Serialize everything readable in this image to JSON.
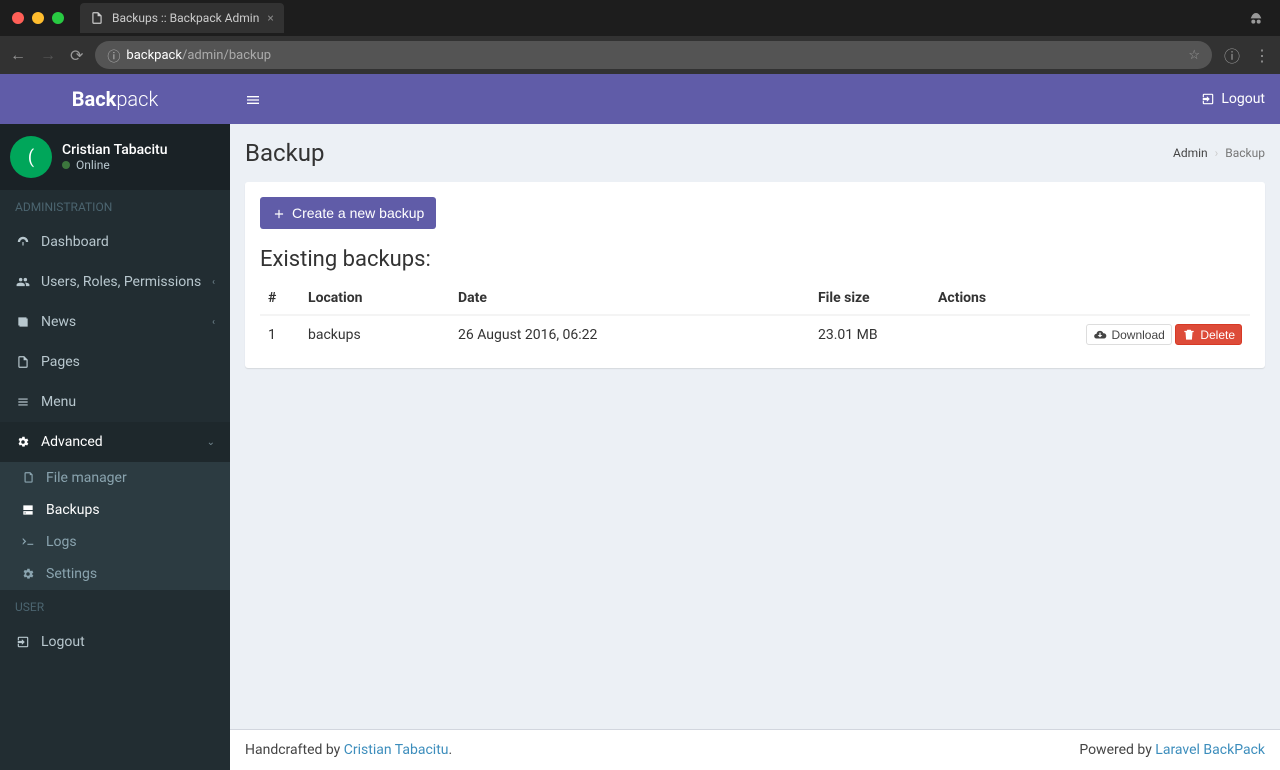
{
  "browser": {
    "tab_title": "Backups :: Backpack Admin",
    "url_host": "backpack",
    "url_path": "/admin/backup"
  },
  "brand": {
    "bold": "Back",
    "light": "pack"
  },
  "topbar": {
    "logout": "Logout"
  },
  "user": {
    "name": "Cristian Tabacitu",
    "status": "Online",
    "avatar_initial": "("
  },
  "sidebar": {
    "section_admin": "ADMINISTRATION",
    "section_user": "USER",
    "items": {
      "dashboard": "Dashboard",
      "users": "Users, Roles, Permissions",
      "news": "News",
      "pages": "Pages",
      "menu": "Menu",
      "advanced": "Advanced",
      "logout": "Logout"
    },
    "advanced_sub": {
      "file_manager": "File manager",
      "backups": "Backups",
      "logs": "Logs",
      "settings": "Settings"
    }
  },
  "page": {
    "title": "Backup",
    "breadcrumb_admin": "Admin",
    "breadcrumb_current": "Backup",
    "create_button": "Create a new backup",
    "section_title": "Existing backups:",
    "columns": {
      "num": "#",
      "location": "Location",
      "date": "Date",
      "size": "File size",
      "actions": "Actions"
    },
    "rows": [
      {
        "num": "1",
        "location": "backups",
        "date": "26 August 2016, 06:22",
        "size": "23.01 MB"
      }
    ],
    "action_download": "Download",
    "action_delete": "Delete"
  },
  "footer": {
    "left_prefix": "Handcrafted by ",
    "left_link": "Cristian Tabacitu",
    "left_suffix": ".",
    "right_prefix": "Powered by ",
    "right_link": "Laravel BackPack"
  }
}
